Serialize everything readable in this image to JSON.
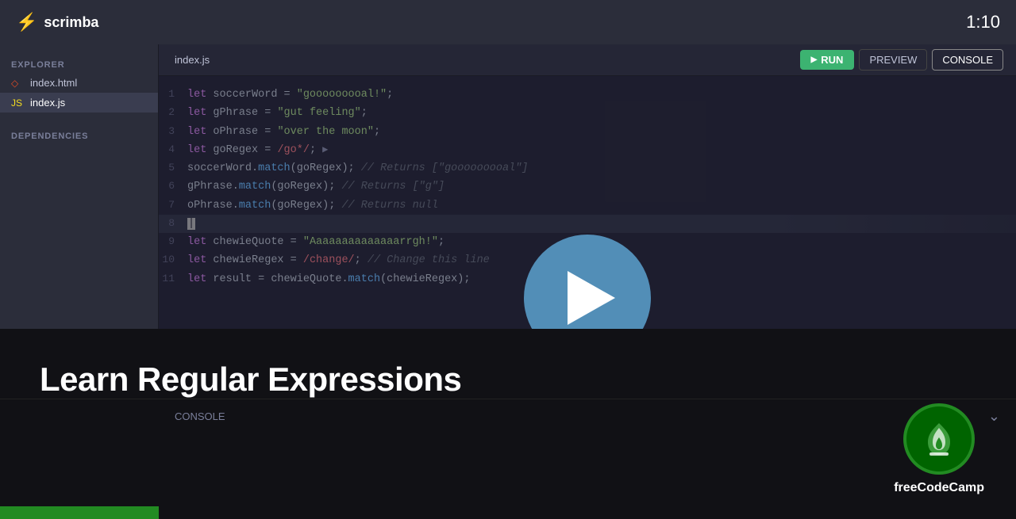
{
  "topnav": {
    "logo_text": "scrimba",
    "timer": "1:10"
  },
  "sidebar": {
    "explorer_label": "EXPLORER",
    "dependencies_label": "DEPENDENCIES",
    "files": [
      {
        "name": "index.html",
        "type": "html",
        "icon": "html-icon"
      },
      {
        "name": "index.js",
        "type": "js",
        "icon": "js-icon",
        "active": true
      }
    ]
  },
  "editor": {
    "active_file": "index.js",
    "run_label": "RUN",
    "preview_label": "PREVIEW",
    "console_label": "CONSOLE",
    "lines": [
      {
        "num": 1,
        "text": "let soccerWord = \"gooooooooal!\";"
      },
      {
        "num": 2,
        "text": "let gPhrase = \"gut feeling\";"
      },
      {
        "num": 3,
        "text": "let oPhrase = \"over the moon\";"
      },
      {
        "num": 4,
        "text": "let goRegex = /go*/;"
      },
      {
        "num": 5,
        "text": "soccerWord.match(goRegex); // Returns [\"gooooooooal\"]"
      },
      {
        "num": 6,
        "text": "gPhrase.match(goRegex); // Returns [\"g\"]"
      },
      {
        "num": 7,
        "text": "oPhrase.match(goRegex); // Returns null"
      },
      {
        "num": 8,
        "text": "["
      },
      {
        "num": 9,
        "text": "let chewieQuote = \"Aaaaaaaaaaaaaarrgh!\";"
      },
      {
        "num": 10,
        "text": "let chewieRegex = /change/; // Change this line"
      },
      {
        "num": 11,
        "text": "let result = chewieQuote.match(chewieRegex);"
      }
    ]
  },
  "bottom": {
    "title": "Learn Regular Expressions",
    "console_label": "CONSOLE",
    "fcc_label": "freeCodeCamp"
  }
}
